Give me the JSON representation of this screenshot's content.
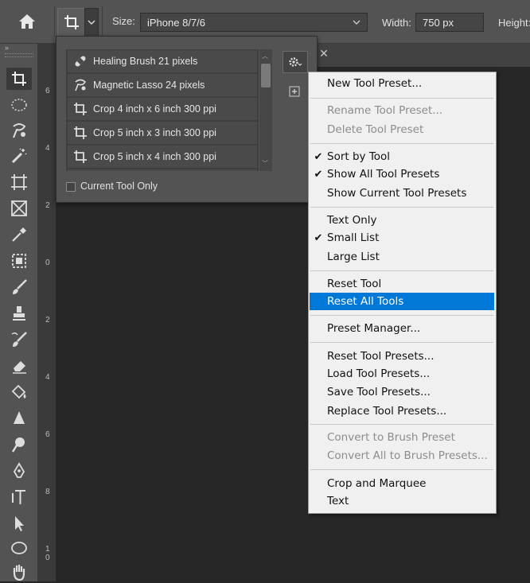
{
  "options_bar": {
    "size_label": "Size:",
    "size_value": "iPhone 8/7/6",
    "width_label": "Width:",
    "width_value": "750 px",
    "height_label": "Height:"
  },
  "ruler": {
    "numbers": [
      "6",
      "4",
      "2",
      "0",
      "2",
      "4",
      "6",
      "8",
      "1\n0"
    ]
  },
  "preset_panel": {
    "items": [
      {
        "label": "Healing Brush 21 pixels",
        "icon": "bandage-icon"
      },
      {
        "label": "Magnetic Lasso 24 pixels",
        "icon": "magnetic-lasso-icon"
      },
      {
        "label": "Crop 4 inch x 6 inch 300 ppi",
        "icon": "crop-icon"
      },
      {
        "label": "Crop 5 inch x 3 inch 300 ppi",
        "icon": "crop-icon"
      },
      {
        "label": "Crop 5 inch x 4 inch 300 ppi",
        "icon": "crop-icon"
      }
    ],
    "current_tool_only_label": "Current Tool Only"
  },
  "context_menu": {
    "new_tool_preset": "New Tool Preset...",
    "rename_tool_preset": "Rename Tool Preset...",
    "delete_tool_preset": "Delete Tool Preset",
    "sort_by_tool": "Sort by Tool",
    "show_all_tool_presets": "Show All Tool Presets",
    "show_current_tool_presets": "Show Current Tool Presets",
    "text_only": "Text Only",
    "small_list": "Small List",
    "large_list": "Large List",
    "reset_tool": "Reset Tool",
    "reset_all_tools": "Reset All Tools",
    "preset_manager": "Preset Manager...",
    "reset_tool_presets": "Reset Tool Presets...",
    "load_tool_presets": "Load Tool Presets...",
    "save_tool_presets": "Save Tool Presets...",
    "replace_tool_presets": "Replace Tool Presets...",
    "convert_to_brush_preset": "Convert to Brush Preset",
    "convert_all_to_brush_presets": "Convert All to Brush Presets...",
    "crop_and_marquee": "Crop and Marquee",
    "text": "Text",
    "checkmark": "✔"
  },
  "colors": {
    "highlight": "#0078d7",
    "ui_gray": "#535353"
  }
}
